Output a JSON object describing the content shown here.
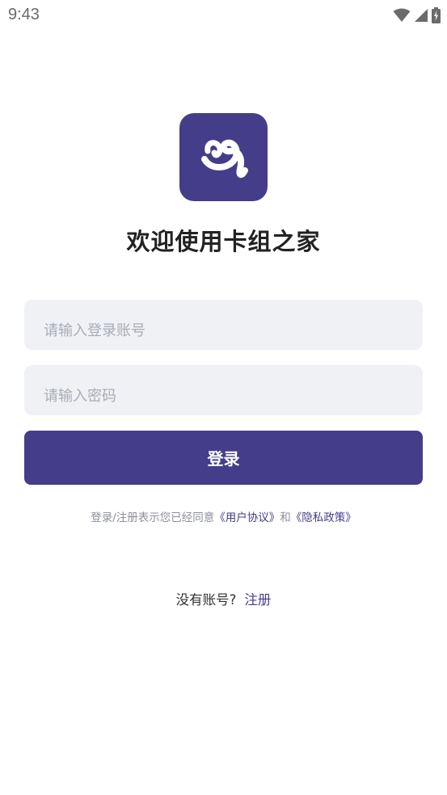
{
  "status_bar": {
    "time": "9:43",
    "icons": [
      "wifi-icon",
      "signal-icon",
      "battery-charging-icon"
    ]
  },
  "app": {
    "logo_icon": "swirl-logo-icon",
    "welcome_title": "欢迎使用卡组之家"
  },
  "form": {
    "account_placeholder": "请输入登录账号",
    "account_value": "",
    "password_placeholder": "请输入密码",
    "password_value": "",
    "login_label": "登录"
  },
  "agreement": {
    "prefix": "登录/注册表示您已经同意",
    "user_agreement": "《用户协议》",
    "conjunction": "和",
    "privacy_policy": "《隐私政策》"
  },
  "register": {
    "question": "没有账号?",
    "link_label": "注册"
  },
  "colors": {
    "brand": "#433d8a",
    "input_bg": "#f0f1f5",
    "placeholder": "#a9acb6",
    "title": "#222222"
  }
}
